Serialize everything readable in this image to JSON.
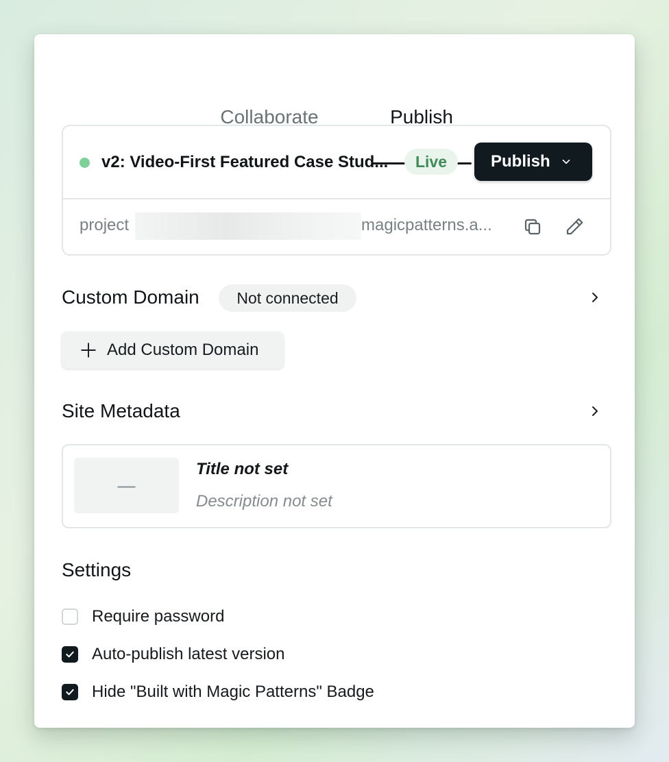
{
  "tabs": [
    {
      "label": "Collaborate",
      "active": false
    },
    {
      "label": "Publish",
      "active": true
    }
  ],
  "version": {
    "title": "v2: Video-First Featured Case Stud...",
    "status": "Live",
    "status_color": "#7fcf98",
    "publish_label": "Publish",
    "url_prefix": "project",
    "url_suffix": "magicpatterns.a..."
  },
  "custom_domain": {
    "title": "Custom Domain",
    "badge": "Not connected",
    "add_label": "Add Custom Domain"
  },
  "site_metadata": {
    "title": "Site Metadata",
    "thumb_placeholder": "—",
    "meta_title": "Title not set",
    "meta_description": "Description not set"
  },
  "settings": {
    "title": "Settings",
    "items": [
      {
        "label": "Require password",
        "checked": false
      },
      {
        "label": "Auto-publish latest version",
        "checked": true
      },
      {
        "label": "Hide \"Built with Magic Patterns\" Badge",
        "checked": true
      }
    ]
  },
  "colors": {
    "primary": "#111a1f",
    "live_bg": "#e8f4ec",
    "live_text": "#3f8a57"
  }
}
